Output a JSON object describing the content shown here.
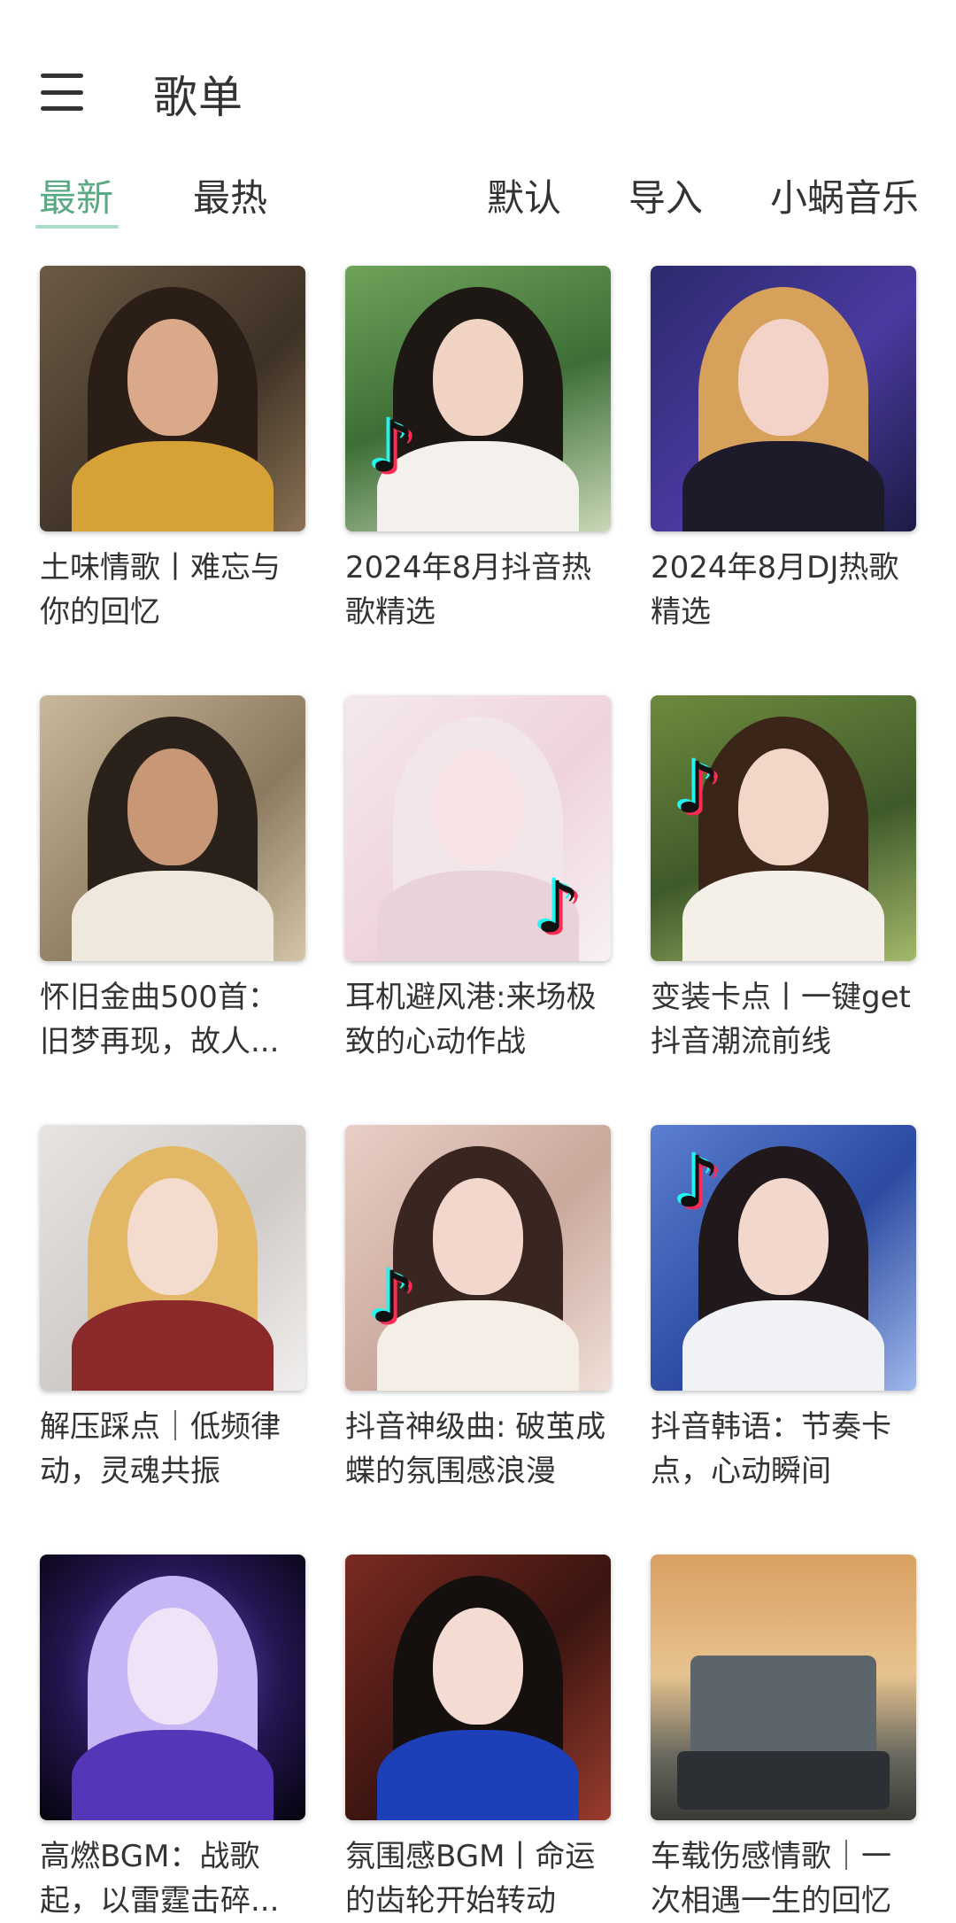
{
  "header": {
    "title": "歌单",
    "menu_icon": "hamburger-menu-icon"
  },
  "tabs": {
    "left": [
      "最新",
      "最热"
    ],
    "right": [
      "默认",
      "导入",
      "小蜗音乐"
    ],
    "active": "最新",
    "accent": "#5aa982"
  },
  "playlists": [
    {
      "title": "土味情歌丨难忘与你的回忆"
    },
    {
      "title": "2024年8月抖音热歌精选"
    },
    {
      "title": "2024年8月DJ热歌精选"
    },
    {
      "title": "怀旧金曲500首：旧梦再现，故人..."
    },
    {
      "title": "耳机避风港:来场极致的心动作战"
    },
    {
      "title": "变装卡点丨一键get抖音潮流前线"
    },
    {
      "title": "解压踩点｜低频律动，灵魂共振"
    },
    {
      "title": "抖音神级曲: 破茧成蝶的氛围感浪漫"
    },
    {
      "title": "抖音韩语：节奏卡点，心动瞬间"
    },
    {
      "title": "高燃BGM：战歌起，以雷霆击碎..."
    },
    {
      "title": "氛围感BGM丨命运的齿轮开始转动"
    },
    {
      "title": "车载伤感情歌｜一次相遇一生的回忆"
    }
  ]
}
